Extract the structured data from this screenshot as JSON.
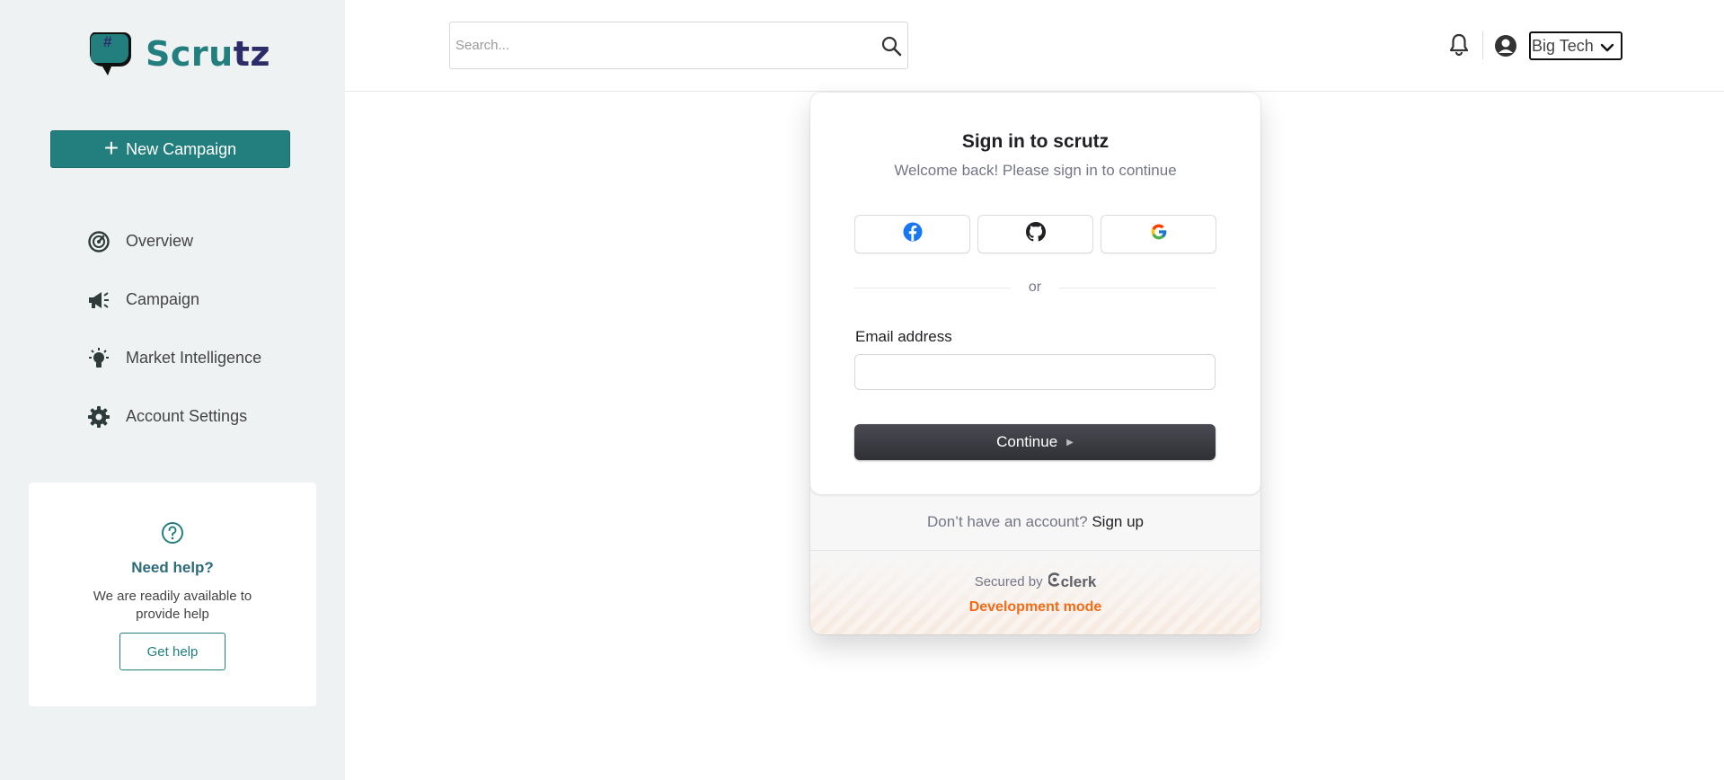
{
  "brand": {
    "name": "Scrutz",
    "mark_symbol": "#",
    "colors": {
      "primary": "#237f7e",
      "text_dark": "#2c2c6b"
    }
  },
  "sidebar": {
    "new_campaign_label": "New Campaign",
    "items": [
      {
        "label": "Overview",
        "icon": "speedometer-icon"
      },
      {
        "label": "Campaign",
        "icon": "megaphone-icon"
      },
      {
        "label": "Market Intelligence",
        "icon": "lightbulb-icon"
      },
      {
        "label": "Account Settings",
        "icon": "gear-icon"
      }
    ],
    "help": {
      "title": "Need help?",
      "text": "We are readily available to provide help",
      "button_label": "Get help"
    }
  },
  "header": {
    "search_placeholder": "Search...",
    "account_name": "Big Tech"
  },
  "signin": {
    "title": "Sign in to scrutz",
    "subtitle": "Welcome back! Please sign in to continue",
    "providers": [
      "facebook",
      "github",
      "google"
    ],
    "or_text": "or",
    "email_label": "Email address",
    "email_value": "",
    "continue_label": "Continue",
    "no_account_text": "Don’t have an account?",
    "signup_label": "Sign up",
    "secured_by": "Secured by",
    "clerk_name": "clerk",
    "dev_mode_label": "Development mode"
  }
}
